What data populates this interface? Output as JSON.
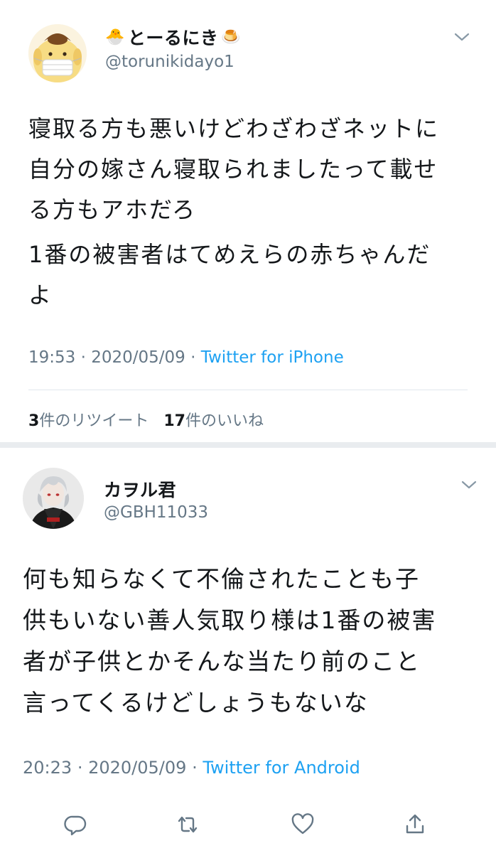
{
  "tweets": [
    {
      "display_name": "とーるにき",
      "emoji_left": "🐣",
      "emoji_right": "🍮",
      "handle": "@torunikidayo1",
      "body": [
        [
          "寝取る方も悪いけどわざわざネットに",
          "自分の嫁さん寝取られましたって載せ",
          "る方もアホだろ"
        ],
        [
          "1番の被害者はてめえらの赤ちゃんだ",
          "よ"
        ]
      ],
      "time": "19:53",
      "date": "2020/05/09",
      "separator": "·",
      "source": "Twitter for iPhone",
      "retweets_count": "3",
      "retweets_label": "件のリツイート",
      "likes_count": "17",
      "likes_label": "件のいいね"
    },
    {
      "display_name": "カヲル君",
      "handle": "@GBH11033",
      "body": [
        [
          "何も知らなくて不倫されたことも子",
          "供もいない善人気取り様は1番の被害",
          "者が子供とかそんな当たり前のこと",
          "言ってくるけどしょうもないな"
        ]
      ],
      "time": "20:23",
      "date": "2020/05/09",
      "separator": "·",
      "source": "Twitter for Android"
    }
  ],
  "icons": {
    "menu": "chevron-down-icon",
    "reply": "reply-icon",
    "retweet": "retweet-icon",
    "like": "heart-icon",
    "share": "share-icon"
  },
  "colors": {
    "link": "#1da1f2",
    "secondary_text": "#657786",
    "divider": "#e1e8ed",
    "icon": "#657786"
  }
}
